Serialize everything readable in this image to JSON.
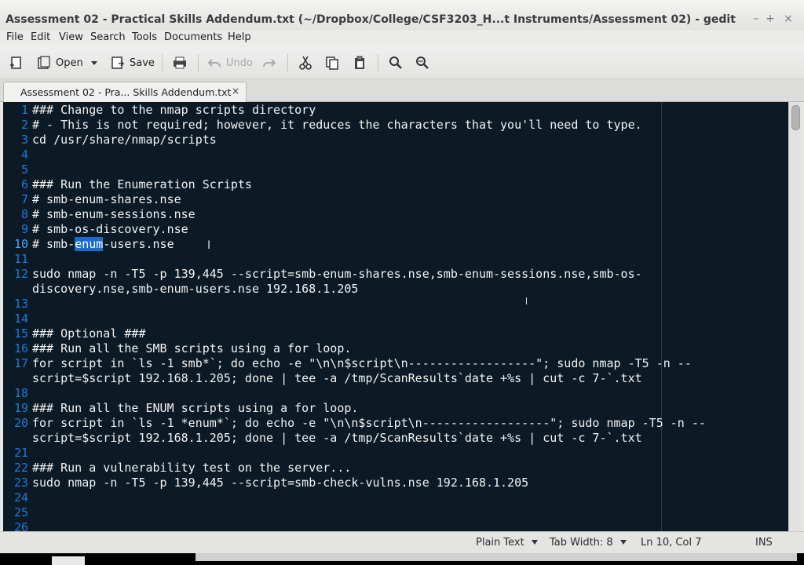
{
  "window": {
    "title": "Assessment 02 - Practical Skills Addendum.txt (~/Dropbox/College/CSF3203_H...t Instruments/Assessment 02) - gedit",
    "controls": {
      "minimize": "–",
      "maximize": "+",
      "close": "×"
    }
  },
  "menubar": [
    "File",
    "Edit",
    "View",
    "Search",
    "Tools",
    "Documents",
    "Help"
  ],
  "toolbar": {
    "open_label": "Open",
    "save_label": "Save",
    "undo_label": "Undo"
  },
  "tab": {
    "label": "Assessment 02 - Pra... Skills Addendum.txt",
    "close": "×"
  },
  "editor": {
    "current_line": 10,
    "selected_word": "enum",
    "lines": [
      {
        "n": "1",
        "text": "### Change to the nmap scripts directory"
      },
      {
        "n": "2",
        "text": "# - This is not required; however, it reduces the characters that you'll need to type."
      },
      {
        "n": "3",
        "text": "cd /usr/share/nmap/scripts"
      },
      {
        "n": "4",
        "text": ""
      },
      {
        "n": "5",
        "text": ""
      },
      {
        "n": "6",
        "text": "### Run the Enumeration Scripts"
      },
      {
        "n": "7",
        "text": "# smb-enum-shares.nse"
      },
      {
        "n": "8",
        "text": "# smb-enum-sessions.nse"
      },
      {
        "n": "9",
        "text": "# smb-os-discovery.nse"
      },
      {
        "n": "10",
        "text": "# smb-enum-users.nse"
      },
      {
        "n": "11",
        "text": ""
      },
      {
        "n": "12",
        "text": "sudo nmap -n -T5 -p 139,445 --script=smb-enum-shares.nse,smb-enum-sessions.nse,smb-os-"
      },
      {
        "n": "",
        "text": "discovery.nse,smb-enum-users.nse 192.168.1.205"
      },
      {
        "n": "13",
        "text": ""
      },
      {
        "n": "14",
        "text": ""
      },
      {
        "n": "15",
        "text": "### Optional ###"
      },
      {
        "n": "16",
        "text": "### Run all the SMB scripts using a for loop."
      },
      {
        "n": "17",
        "text": "for script in `ls -1 smb*`; do echo -e \"\\n\\n$script\\n------------------\"; sudo nmap -T5 -n --"
      },
      {
        "n": "",
        "text": "script=$script 192.168.1.205; done | tee -a /tmp/ScanResults`date +%s | cut -c 7-`.txt"
      },
      {
        "n": "18",
        "text": ""
      },
      {
        "n": "19",
        "text": "### Run all the ENUM scripts using a for loop."
      },
      {
        "n": "20",
        "text": "for script in `ls -1 *enum*`; do echo -e \"\\n\\n$script\\n------------------\"; sudo nmap -T5 -n --"
      },
      {
        "n": "",
        "text": "script=$script 192.168.1.205; done | tee -a /tmp/ScanResults`date +%s | cut -c 7-`.txt"
      },
      {
        "n": "21",
        "text": ""
      },
      {
        "n": "22",
        "text": "### Run a vulnerability test on the server..."
      },
      {
        "n": "23",
        "text": "sudo nmap -n -T5 -p 139,445 --script=smb-check-vulns.nse 192.168.1.205"
      },
      {
        "n": "24",
        "text": ""
      },
      {
        "n": "25",
        "text": ""
      },
      {
        "n": "26",
        "text": ""
      }
    ],
    "line10_parts": {
      "before": "# smb-",
      "selected": "enum",
      "after": "-users.nse"
    }
  },
  "statusbar": {
    "language": "Plain Text",
    "tab_width": "Tab Width:  8",
    "position": "Ln 10, Col 7",
    "mode": "INS"
  }
}
